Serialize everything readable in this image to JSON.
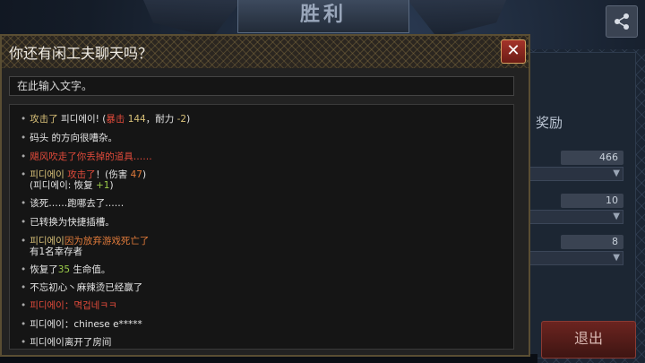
{
  "background": {
    "victory_title": "胜利",
    "reward_label": "奖励",
    "rewards": [
      "466",
      "10",
      "8"
    ],
    "exit_label": "退出"
  },
  "chat": {
    "title": "你还有闲工夫聊天吗？",
    "input_placeholder": "在此输入文字。",
    "close_label": "✕",
    "messages": [
      {
        "parts": [
          {
            "text": "攻击了 ",
            "color": "yellow"
          },
          {
            "text": "피디에이! (",
            "color": "white"
          },
          {
            "text": "暴击 ",
            "color": "red"
          },
          {
            "text": "144",
            "color": "yellow"
          },
          {
            "text": "，耐力 ",
            "color": "white"
          },
          {
            "text": "-2",
            "color": "yellow"
          },
          {
            "text": ")",
            "color": "white"
          }
        ]
      },
      {
        "parts": [
          {
            "text": "码头 的方向很嘈杂。",
            "color": "white"
          }
        ]
      },
      {
        "parts": [
          {
            "text": "飓风吹走了你丢掉的道具……",
            "color": "red"
          }
        ]
      },
      {
        "parts": [
          {
            "text": "피디에이 ",
            "color": "yellow"
          },
          {
            "text": "攻击了",
            "color": "red"
          },
          {
            "text": "！(伤害 ",
            "color": "white"
          },
          {
            "text": "47",
            "color": "orange"
          },
          {
            "text": ")",
            "color": "white"
          }
        ],
        "line2": [
          {
            "text": "(피디에이: 恢复 ",
            "color": "white"
          },
          {
            "text": "+1",
            "color": "green"
          },
          {
            "text": ")",
            "color": "white"
          }
        ]
      },
      {
        "parts": [
          {
            "text": "该死……跑哪去了……",
            "color": "white"
          }
        ]
      },
      {
        "parts": [
          {
            "text": "已转换为快捷插槽。",
            "color": "white"
          }
        ]
      },
      {
        "parts": [
          {
            "text": "피디에이",
            "color": "yellow"
          },
          {
            "text": "因为放弃游戏死亡了",
            "color": "orange"
          }
        ],
        "line2": [
          {
            "text": "有1名幸存者",
            "color": "white"
          }
        ]
      },
      {
        "parts": [
          {
            "text": "恢复了",
            "color": "white"
          },
          {
            "text": "35",
            "color": "green"
          },
          {
            "text": " 生命值。",
            "color": "white"
          }
        ]
      },
      {
        "parts": [
          {
            "text": "不忘初心丶麻辣烫已经赢了",
            "color": "white"
          }
        ]
      },
      {
        "parts": [
          {
            "text": "피디에이：멱겁네ㅋㅋ",
            "color": "red"
          }
        ]
      },
      {
        "parts": [
          {
            "text": "피디에이：chinese e*****",
            "color": "white"
          }
        ]
      },
      {
        "parts": [
          {
            "text": "피디에이离开了房间",
            "color": "white"
          }
        ]
      }
    ]
  }
}
